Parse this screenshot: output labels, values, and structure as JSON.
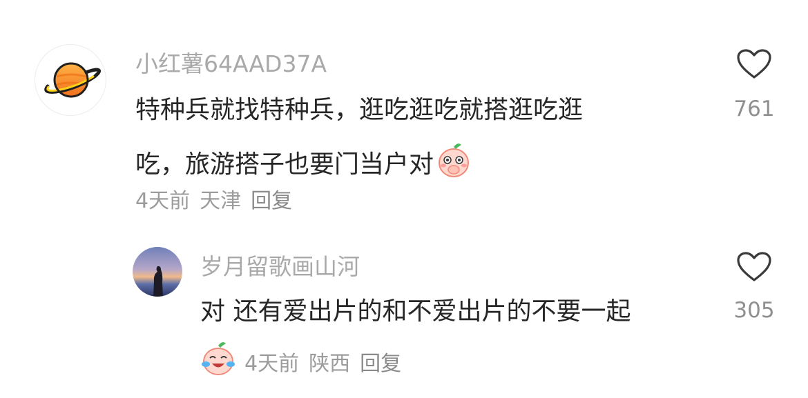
{
  "comments": [
    {
      "username": "小红薯64AAD37A",
      "text_line1": "特种兵就找特种兵，逛吃逛吃就搭逛吃逛",
      "text_line2": "吃，旅游搭子也要门当户对",
      "emoji": "peach-face-hand-on-mouth-emoji",
      "time": "4天前",
      "location": "天津",
      "reply_label": "回复",
      "like_count": "761",
      "avatar_icon": "saturn-planet-icon"
    },
    {
      "username": "岁月留歌画山河",
      "text": "对 还有爱出片的和不爱出片的不要一起",
      "emoji": "peach-face-laughing-tears-emoji",
      "time": "4天前",
      "location": "陕西",
      "reply_label": "回复",
      "like_count": "305",
      "avatar_icon": "sunset-silhouette-photo"
    }
  ],
  "colors": {
    "username": "#a9a9a9",
    "text": "#262626",
    "meta": "#9c9c9c",
    "like_icon": "#3a3a3a"
  }
}
